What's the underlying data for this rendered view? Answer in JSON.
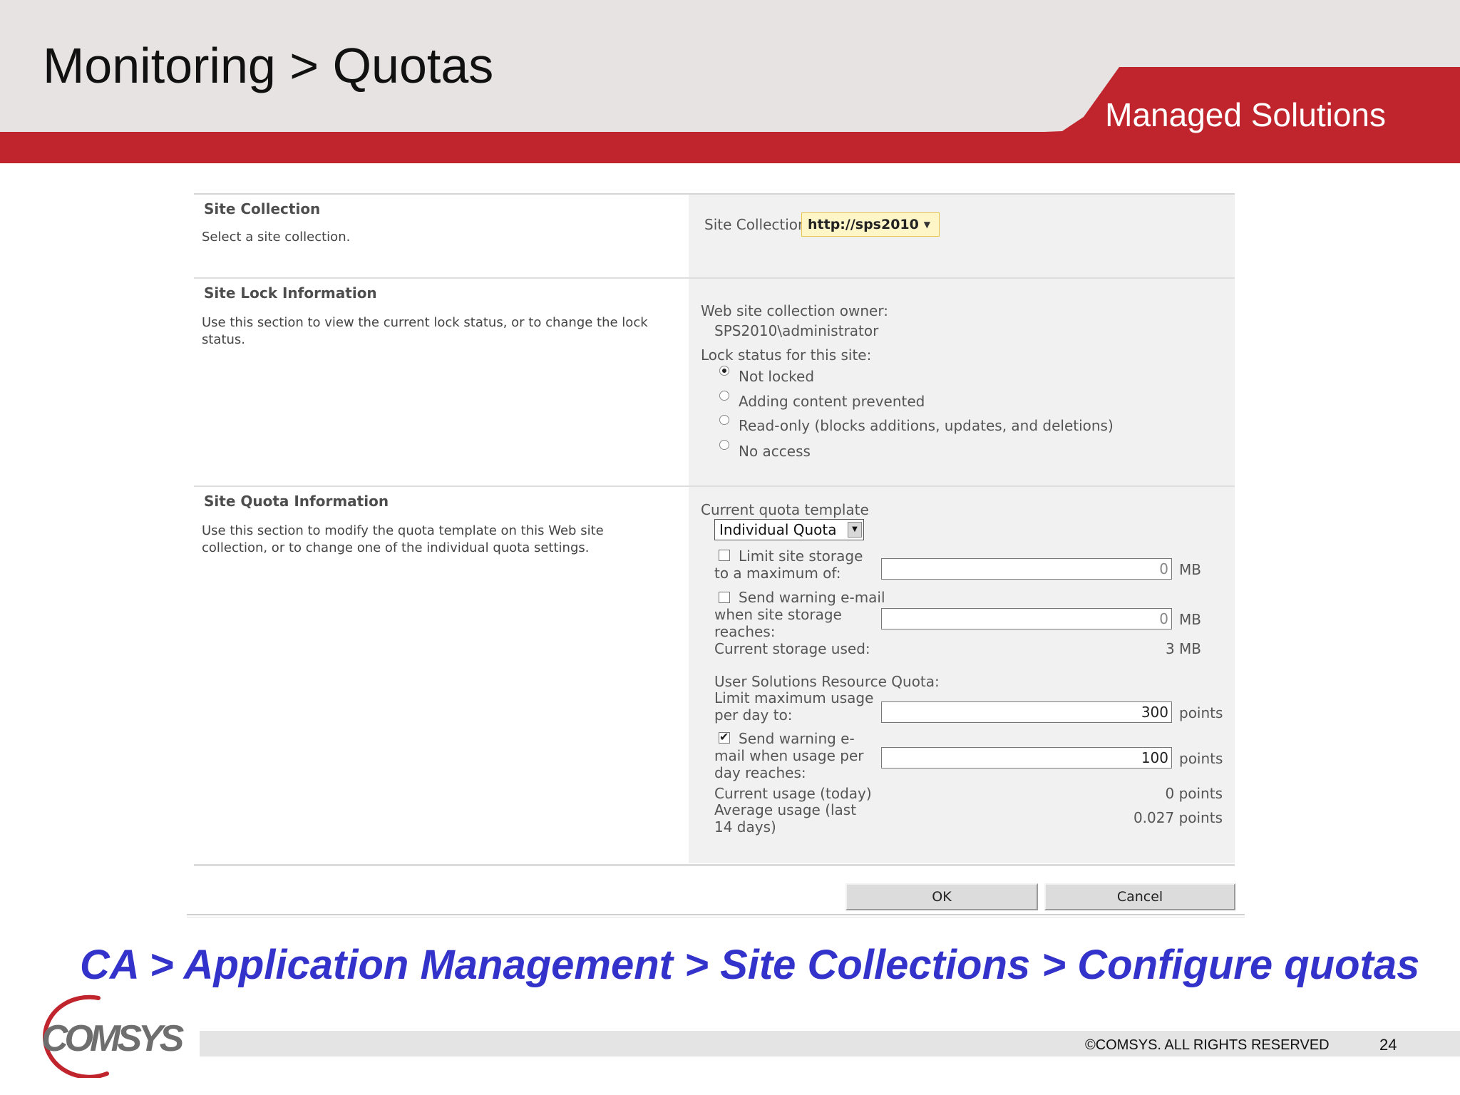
{
  "slide": {
    "title": "Monitoring > Quotas",
    "brand": "Managed Solutions",
    "path": "CA > Application Management > Site Collections > Configure quotas",
    "copyright": "©COMSYS. ALL RIGHTS RESERVED",
    "page_number": "24",
    "logo_text": "COMSYS"
  },
  "sections": {
    "site_collection": {
      "title": "Site Collection",
      "description": "Select a site collection.",
      "label": "Site Collection:",
      "value": "http://sps2010"
    },
    "site_lock": {
      "title": "Site Lock Information",
      "description": "Use this section to view the current lock status, or to change the lock status.",
      "owner_label": "Web site collection owner:",
      "owner_value": "SPS2010\\administrator",
      "lock_label": "Lock status for this site:",
      "options": [
        {
          "label": "Not locked",
          "selected": true
        },
        {
          "label": "Adding content prevented",
          "selected": false
        },
        {
          "label": "Read-only (blocks additions, updates, and deletions)",
          "selected": false
        },
        {
          "label": "No access",
          "selected": false
        }
      ]
    },
    "site_quota": {
      "title": "Site Quota Information",
      "description": "Use this section to modify the quota template on this Web site collection, or to change one of the individual quota settings.",
      "template_label": "Current quota template",
      "template_value": "Individual Quota",
      "limit_storage_label": "Limit site storage to a maximum of:",
      "limit_storage_checked": false,
      "limit_storage_value": "0",
      "limit_storage_unit": "MB",
      "warn_storage_label": "Send warning e-mail when site storage reaches:",
      "warn_storage_checked": false,
      "warn_storage_value": "0",
      "warn_storage_unit": "MB",
      "current_storage_label": "Current storage used:",
      "current_storage_value": "3 MB",
      "user_solutions_label": "User Solutions Resource Quota:",
      "limit_usage_label": "Limit maximum usage per day to:",
      "limit_usage_value": "300",
      "limit_usage_unit": "points",
      "warn_usage_label": "Send warning e-mail when usage per day reaches:",
      "warn_usage_checked": true,
      "warn_usage_value": "100",
      "warn_usage_unit": "points",
      "current_usage_label": "Current usage (today)",
      "current_usage_value": "0 points",
      "average_usage_label": "Average usage (last 14 days)",
      "average_usage_value": "0.027 points"
    }
  },
  "buttons": {
    "ok": "OK",
    "cancel": "Cancel"
  },
  "colors": {
    "brand_red": "#c0242c",
    "path_blue": "#3333cc",
    "header_gray": "#e6e3e2"
  }
}
